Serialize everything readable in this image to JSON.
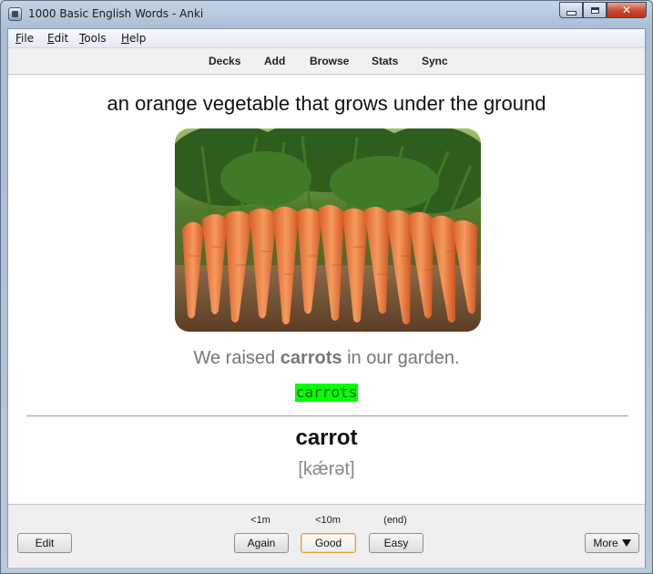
{
  "window": {
    "title": "1000 Basic English Words - Anki"
  },
  "menubar": [
    {
      "label": "File",
      "accel": "F",
      "rest": "ile"
    },
    {
      "label": "Edit",
      "accel": "E",
      "rest": "dit"
    },
    {
      "label": "Tools",
      "accel": "T",
      "rest": "ools"
    },
    {
      "label": "Help",
      "accel": "H",
      "rest": "elp"
    }
  ],
  "toolbar": {
    "decks": "Decks",
    "add": "Add",
    "browse": "Browse",
    "stats": "Stats",
    "sync": "Sync"
  },
  "card": {
    "definition": "an orange vegetable that grows under the ground",
    "image_alt": "bunch of carrots",
    "sentence_before": "We raised ",
    "sentence_bold": "carrots",
    "sentence_after": " in our garden.",
    "typed_answer": "carrots",
    "word": "carrot",
    "ipa": "[kǽrət]"
  },
  "answer_bar": {
    "edit": "Edit",
    "again": {
      "label": "Again",
      "interval": "<1m"
    },
    "good": {
      "label": "Good",
      "interval": "<10m"
    },
    "easy": {
      "label": "Easy",
      "interval": "(end)"
    },
    "more": "More"
  },
  "colors": {
    "typed_highlight": "#00ff00",
    "good_border": "#e0a14a",
    "close_button": "#c74a2f"
  }
}
